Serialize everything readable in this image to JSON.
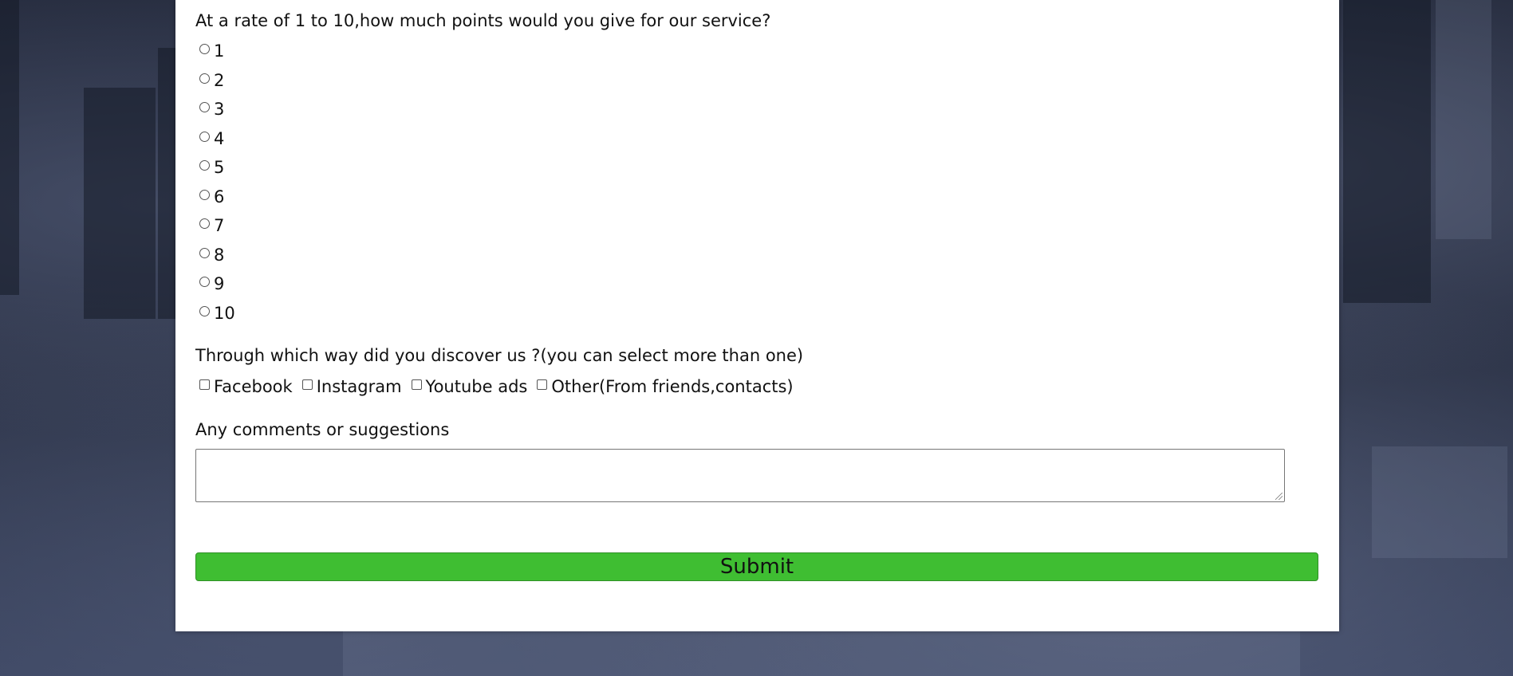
{
  "rating": {
    "question": "At a rate of 1 to 10,how much points would you give for our service?",
    "options": [
      "1",
      "2",
      "3",
      "4",
      "5",
      "6",
      "7",
      "8",
      "9",
      "10"
    ]
  },
  "discovery": {
    "question": "Through which way did you discover us ?(you can select more than one)",
    "options": [
      "Facebook",
      "Instagram",
      "Youtube ads",
      "Other(From friends,contacts)"
    ]
  },
  "comments": {
    "label": "Any comments or suggestions",
    "value": ""
  },
  "submit": {
    "label": "Submit"
  },
  "colors": {
    "submit_background": "#3fbe32",
    "card_background": "#ffffff",
    "page_background": "#2c3347"
  }
}
